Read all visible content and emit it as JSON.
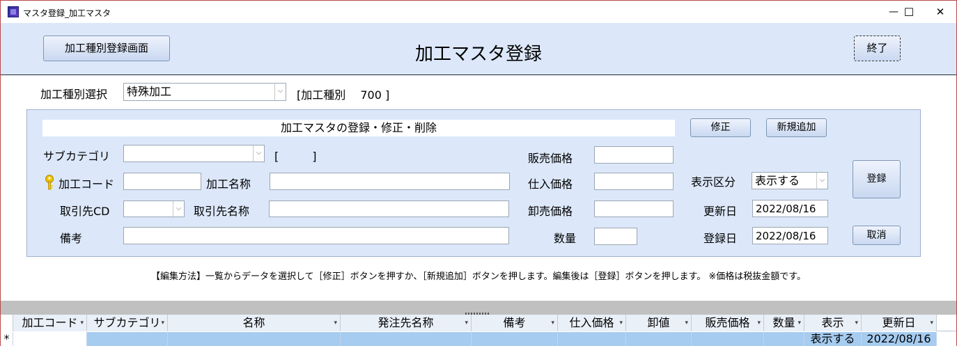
{
  "window": {
    "title": "マスタ登録_加工マスタ",
    "minimize": "—",
    "maximize": "☐",
    "close": "✕"
  },
  "header": {
    "category_register_button": "加工種別登録画面",
    "title": "加工マスタ登録",
    "exit_button": "終了"
  },
  "selector": {
    "label": "加工種別選択",
    "value": "特殊加工",
    "info": "[加工種別　 700 ]"
  },
  "panel": {
    "title": "加工マスタの登録・修正・削除",
    "edit_button": "修正",
    "add_button": "新規追加",
    "register_button": "登録",
    "cancel_button": "取消",
    "subcategory_label": "サブカテゴリ",
    "subcategory_value": "",
    "subcategory_bracket": "[　　　]",
    "code_label": "加工コード",
    "code_value": "",
    "name_label": "加工名称",
    "name_value": "",
    "supplier_cd_label": "取引先CD",
    "supplier_cd_value": "",
    "supplier_name_label": "取引先名称",
    "supplier_name_value": "",
    "remarks_label": "備考",
    "remarks_value": "",
    "sale_price_label": "販売価格",
    "sale_price_value": "",
    "purchase_price_label": "仕入価格",
    "purchase_price_value": "",
    "wholesale_price_label": "卸売価格",
    "wholesale_price_value": "",
    "quantity_label": "数量",
    "quantity_value": "",
    "display_label": "表示区分",
    "display_value": "表示する",
    "updated_label": "更新日",
    "updated_value": "2022/08/16",
    "created_label": "登録日",
    "created_value": "2022/08/16"
  },
  "help_text": "【編集方法】一覧からデータを選択して［修正］ボタンを押すか、［新規追加］ボタンを押します。編集後は［登録］ボタンを押します。 ※価格は税抜金額です。",
  "table": {
    "columns": [
      "加工コード",
      "サブカテゴリ",
      "名称",
      "発注先名称",
      "備考",
      "仕入価格",
      "卸値",
      "販売価格",
      "数量",
      "表示",
      "更新日"
    ],
    "new_row_marker": "*",
    "new_row": [
      "",
      "",
      "",
      "",
      "",
      "",
      "",
      "",
      "",
      "表示する",
      "2022/08/16"
    ]
  },
  "colors": {
    "header_bg": "#dce8fa",
    "panel_bg": "#dce8fa",
    "selected_row": "#a6ccf0",
    "key_icon": "#f2c200"
  }
}
